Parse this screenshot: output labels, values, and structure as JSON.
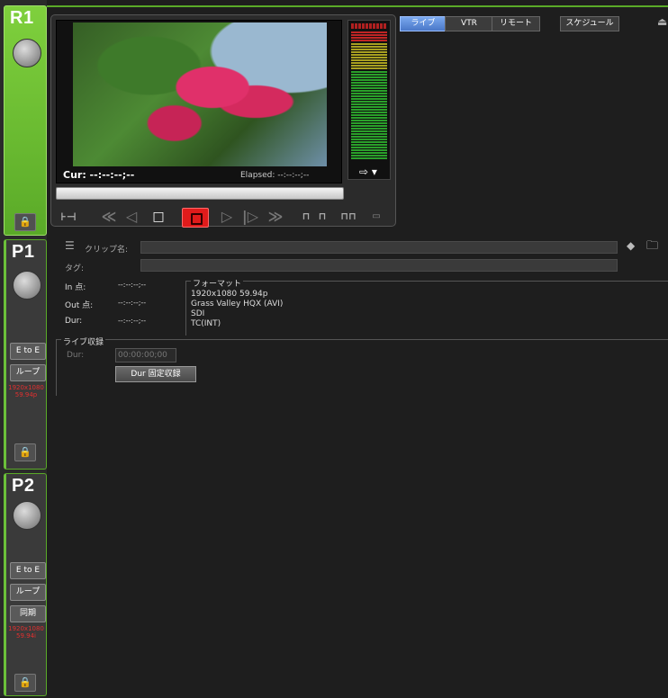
{
  "channels": {
    "r1": {
      "title": "R1"
    },
    "p1": {
      "title": "P1",
      "e_to_e": "E to E",
      "loop": "ループ",
      "format": "1920x1080\n59.94p"
    },
    "p2": {
      "title": "P2",
      "e_to_e": "E to E",
      "loop": "ループ",
      "sync": "同期",
      "format": "1920x1080\n59.94i"
    }
  },
  "player": {
    "cur_label": "Cur: --:--:--;--",
    "elapsed_label": "Elapsed: --:--:--;--",
    "meter_arrow": "⇨ ▾"
  },
  "tabs": [
    {
      "label": "ライブ"
    },
    {
      "label": "VTR"
    },
    {
      "label": "リモート"
    },
    {
      "label": "スケジュール"
    }
  ],
  "clip": {
    "name_label": "クリップ名:",
    "tag_label": "タグ:",
    "in_label": "In 点:",
    "in_value": "--:--:--;--",
    "out_label": "Out 点:",
    "out_value": "--:--:--;--",
    "dur_label": "Dur:",
    "dur_value": "--:--:--;--"
  },
  "format": {
    "heading": "フォーマット",
    "line1": "1920x1080 59.94p",
    "line2": "Grass Valley HQX (AVI)",
    "line3": "SDI",
    "line4": "TC(INT)"
  },
  "live_record": {
    "heading": "ライブ収録",
    "dur_label": "Dur:",
    "dur_value": "00:00:00;00",
    "fixed_button": "Dur 固定収録"
  },
  "colors": {
    "accent_green": "#5aaa28",
    "record_red": "#e01b1b",
    "tab_active": "#5a8ad8"
  }
}
